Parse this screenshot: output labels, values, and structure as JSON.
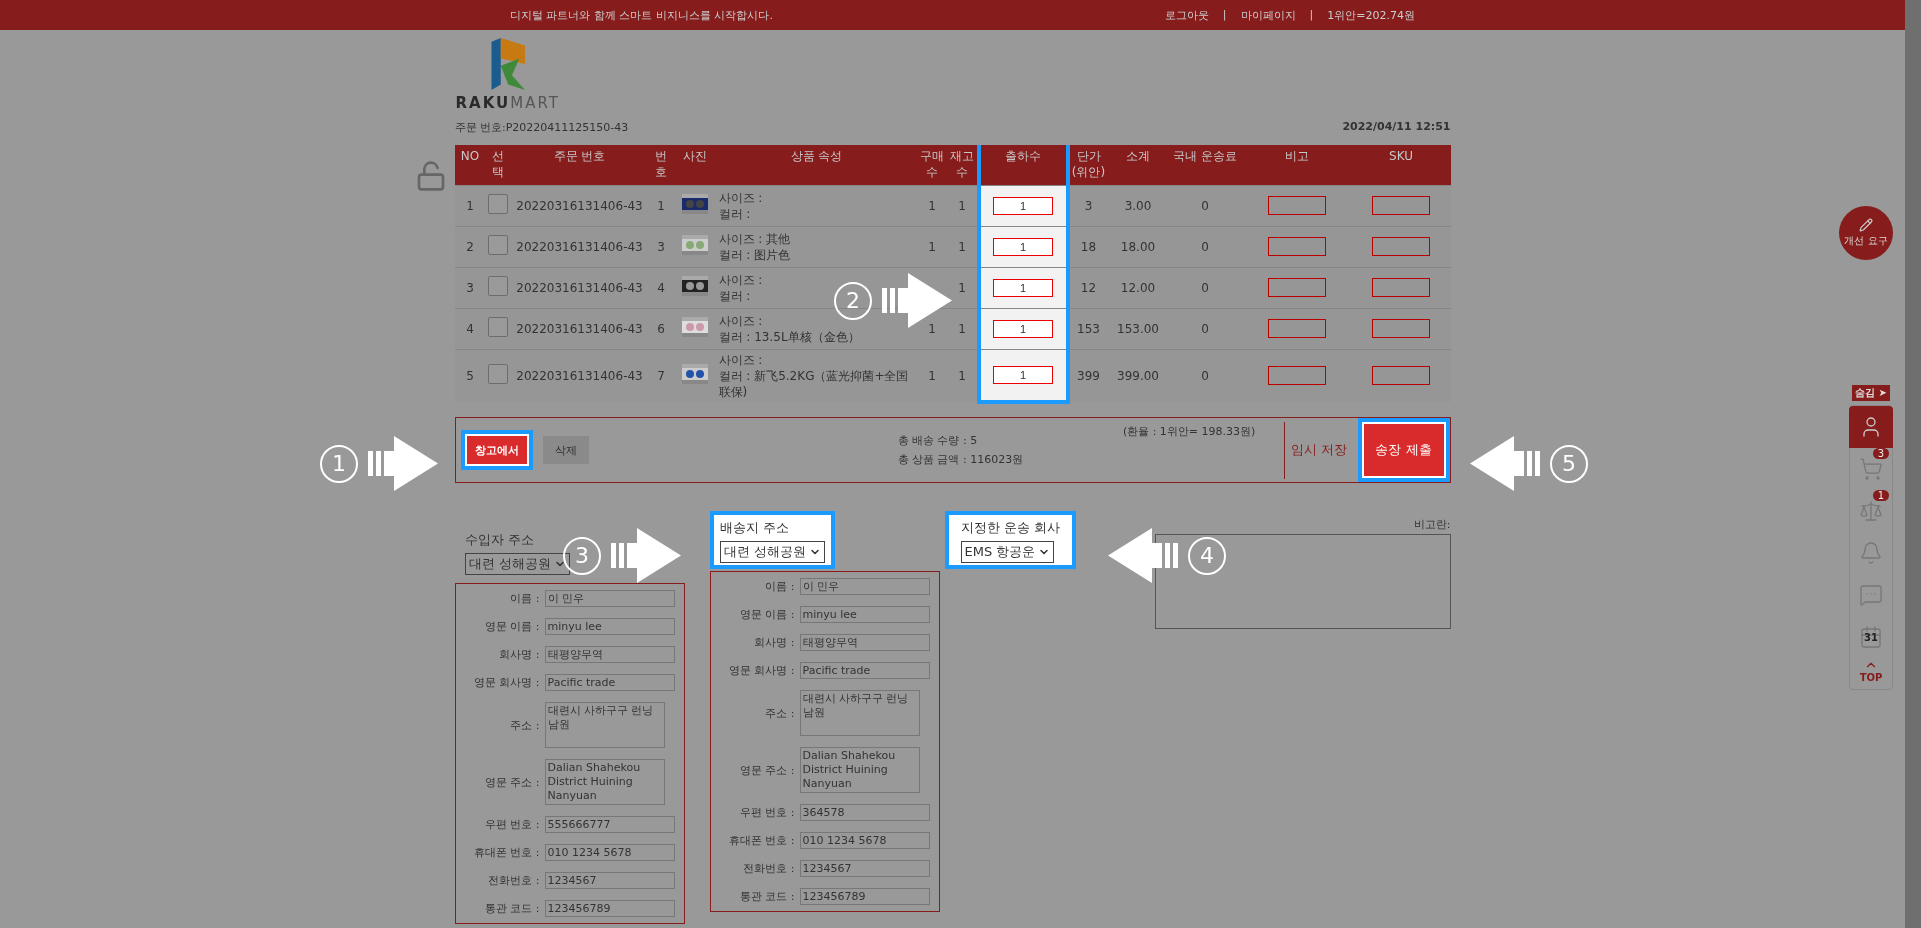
{
  "top_bar": {
    "slogan": "디지털 파트너와 함께 스마트 비지니스를 시작합시다.",
    "links": [
      {
        "label": "로그아웃"
      },
      {
        "label": "|"
      },
      {
        "label": "마이페이지"
      },
      {
        "label": "|"
      },
      {
        "label": "1위안=202.74원"
      }
    ]
  },
  "logo": {
    "strong": "RAKU",
    "light": "MART"
  },
  "order": {
    "number": "주문 번호:P20220411125150-43",
    "date": "2022/04/11 12:51"
  },
  "table": {
    "columns": [
      {
        "label": "NO",
        "highlighted": false
      },
      {
        "label": "선택",
        "highlighted": false
      },
      {
        "label": "주문 번호",
        "highlighted": false
      },
      {
        "label": "번호",
        "highlighted": false
      },
      {
        "label": "사진",
        "highlighted": false
      },
      {
        "label": "상품 속성",
        "highlighted": false
      },
      {
        "label": "구매수",
        "highlighted": false
      },
      {
        "label": "재고수",
        "highlighted": false
      },
      {
        "label": "출하수",
        "highlighted": true
      },
      {
        "label": "단가 (위안)",
        "highlighted": false
      },
      {
        "label": "소계",
        "highlighted": false
      },
      {
        "label": "국내 운송료",
        "highlighted": false
      },
      {
        "label": "비고",
        "highlighted": false
      },
      {
        "label": "SKU",
        "highlighted": false
      }
    ],
    "rows": [
      {
        "no": "1",
        "checked": false,
        "order": "20220316131406-43",
        "num": "1",
        "size": "사이즈 :",
        "color_attr": "컬러 :",
        "purchase": "1",
        "stock": "1",
        "ship": "1",
        "price": "3",
        "subtotal": "3.00",
        "shipping": "0"
      },
      {
        "no": "2",
        "checked": false,
        "order": "20220316131406-43",
        "num": "3",
        "size": "사이즈 : 其他",
        "color_attr": "컬러 : 图片色",
        "purchase": "1",
        "stock": "1",
        "ship": "1",
        "price": "18",
        "subtotal": "18.00",
        "shipping": "0"
      },
      {
        "no": "3",
        "checked": false,
        "order": "20220316131406-43",
        "num": "4",
        "size": "사이즈 :",
        "color_attr": "컬러 :",
        "stock": "1",
        "ship": "1",
        "price": "12",
        "subtotal": "12.00",
        "shipping": "0"
      },
      {
        "no": "4",
        "checked": false,
        "order": "20220316131406-43",
        "num": "6",
        "size": "사이즈 :",
        "color_attr": "컬러 : 13.5L单核（金色）",
        "purchase": "1",
        "stock": "1",
        "ship": "1",
        "price": "153",
        "subtotal": "153.00",
        "shipping": "0"
      },
      {
        "no": "5",
        "checked": false,
        "order": "20220316131406-43",
        "num": "7",
        "size": "사이즈 :",
        "color_attr": "컬러 : 新飞5.2KG（蓝光抑菌+全国联保)",
        "purchase": "1",
        "stock": "1",
        "ship": "1",
        "price": "399",
        "subtotal": "399.00",
        "shipping": "0"
      }
    ]
  },
  "actions": {
    "warehouse_button": {
      "label": "창고에서",
      "highlighted": true
    },
    "delete_button": {
      "label": "삭제",
      "highlighted": false
    },
    "total_qty": "총 배송 수량 : 5",
    "total_amount": "총 상품 금액 : 116023원",
    "rate": "(환율 : 1위안= 198.33원)",
    "save_button": {
      "label": "임시 저장",
      "highlighted": false
    },
    "submit_button": {
      "label": "송장 제출",
      "highlighted": true
    }
  },
  "importer": {
    "label": "수입자 주소",
    "select": "대련 성해공원",
    "highlighted": false
  },
  "destination": {
    "label": "배송지 주소",
    "select": "대련 성해공원",
    "highlighted": true
  },
  "carrier": {
    "label": "지정한 운송 회사",
    "select": "EMS 항공운",
    "highlighted": true
  },
  "memo": {
    "label": "비고란:"
  },
  "address_cards": [
    {
      "fields": [
        {
          "kind": "line",
          "label": "이름 :",
          "value": "이 민우"
        },
        {
          "kind": "line",
          "label": "영문 이름 :",
          "value": "minyu lee"
        },
        {
          "kind": "line",
          "label": "회사명 :",
          "value": "태평양무역"
        },
        {
          "kind": "line",
          "label": "영문 회사명 :",
          "value": "Pacific trade"
        },
        {
          "kind": "area",
          "label": "주소 :",
          "value": "대련시 사하구구 런닝남원"
        },
        {
          "kind": "area",
          "label": "영문 주소 :",
          "value": "Dalian Shahekou District Huining Nanyuan"
        },
        {
          "kind": "line",
          "label": "우편 번호 :",
          "value": "555666777"
        },
        {
          "kind": "line",
          "label": "휴대폰 번호 :",
          "value": "010 1234 5678"
        },
        {
          "kind": "line",
          "label": "전화번호 :",
          "value": "1234567"
        },
        {
          "kind": "line",
          "label": "통관 코드 :",
          "value": "123456789"
        }
      ]
    },
    {
      "fields": [
        {
          "kind": "line",
          "label": "이름 :",
          "value": "이 민우"
        },
        {
          "kind": "line",
          "label": "영문 이름 :",
          "value": "minyu lee"
        },
        {
          "kind": "line",
          "label": "회사명 :",
          "value": "태평양무역"
        },
        {
          "kind": "line",
          "label": "영문 회사명 :",
          "value": "Pacific trade"
        },
        {
          "kind": "area",
          "label": "주소 :",
          "value": "대련시 사하구구 런닝남원"
        },
        {
          "kind": "area",
          "label": "영문 주소 :",
          "value": "Dalian Shahekou District Huining Nanyuan"
        },
        {
          "kind": "line",
          "label": "우편 번호 :",
          "value": "364578"
        },
        {
          "kind": "line",
          "label": "휴대폰 번호 :",
          "value": "010 1234 5678"
        },
        {
          "kind": "line",
          "label": "전화번호 :",
          "value": "1234567"
        },
        {
          "kind": "line",
          "label": "통관 코드 :",
          "value": "123456789"
        }
      ]
    }
  ],
  "annotations": [
    {
      "number": "1",
      "kind": "right_arrow"
    },
    {
      "number": "2",
      "kind": "right_arrow"
    },
    {
      "number": "3",
      "kind": "right_arrow"
    },
    {
      "number": "4",
      "kind": "left_arrow"
    },
    {
      "number": "5",
      "kind": "left_arrow"
    }
  ],
  "sidebar": {
    "feedback": "개선 요구",
    "hide": "숨김 ➤",
    "items": [
      {
        "kind": "user",
        "selected": true
      },
      {
        "kind": "cart",
        "badge": "3",
        "selected": false
      },
      {
        "kind": "scale",
        "badge": "1",
        "selected": false
      },
      {
        "kind": "bell",
        "selected": false
      },
      {
        "kind": "chat",
        "selected": false
      },
      {
        "kind": "calendar",
        "day": "31",
        "selected": false
      }
    ],
    "top": "TOP"
  }
}
